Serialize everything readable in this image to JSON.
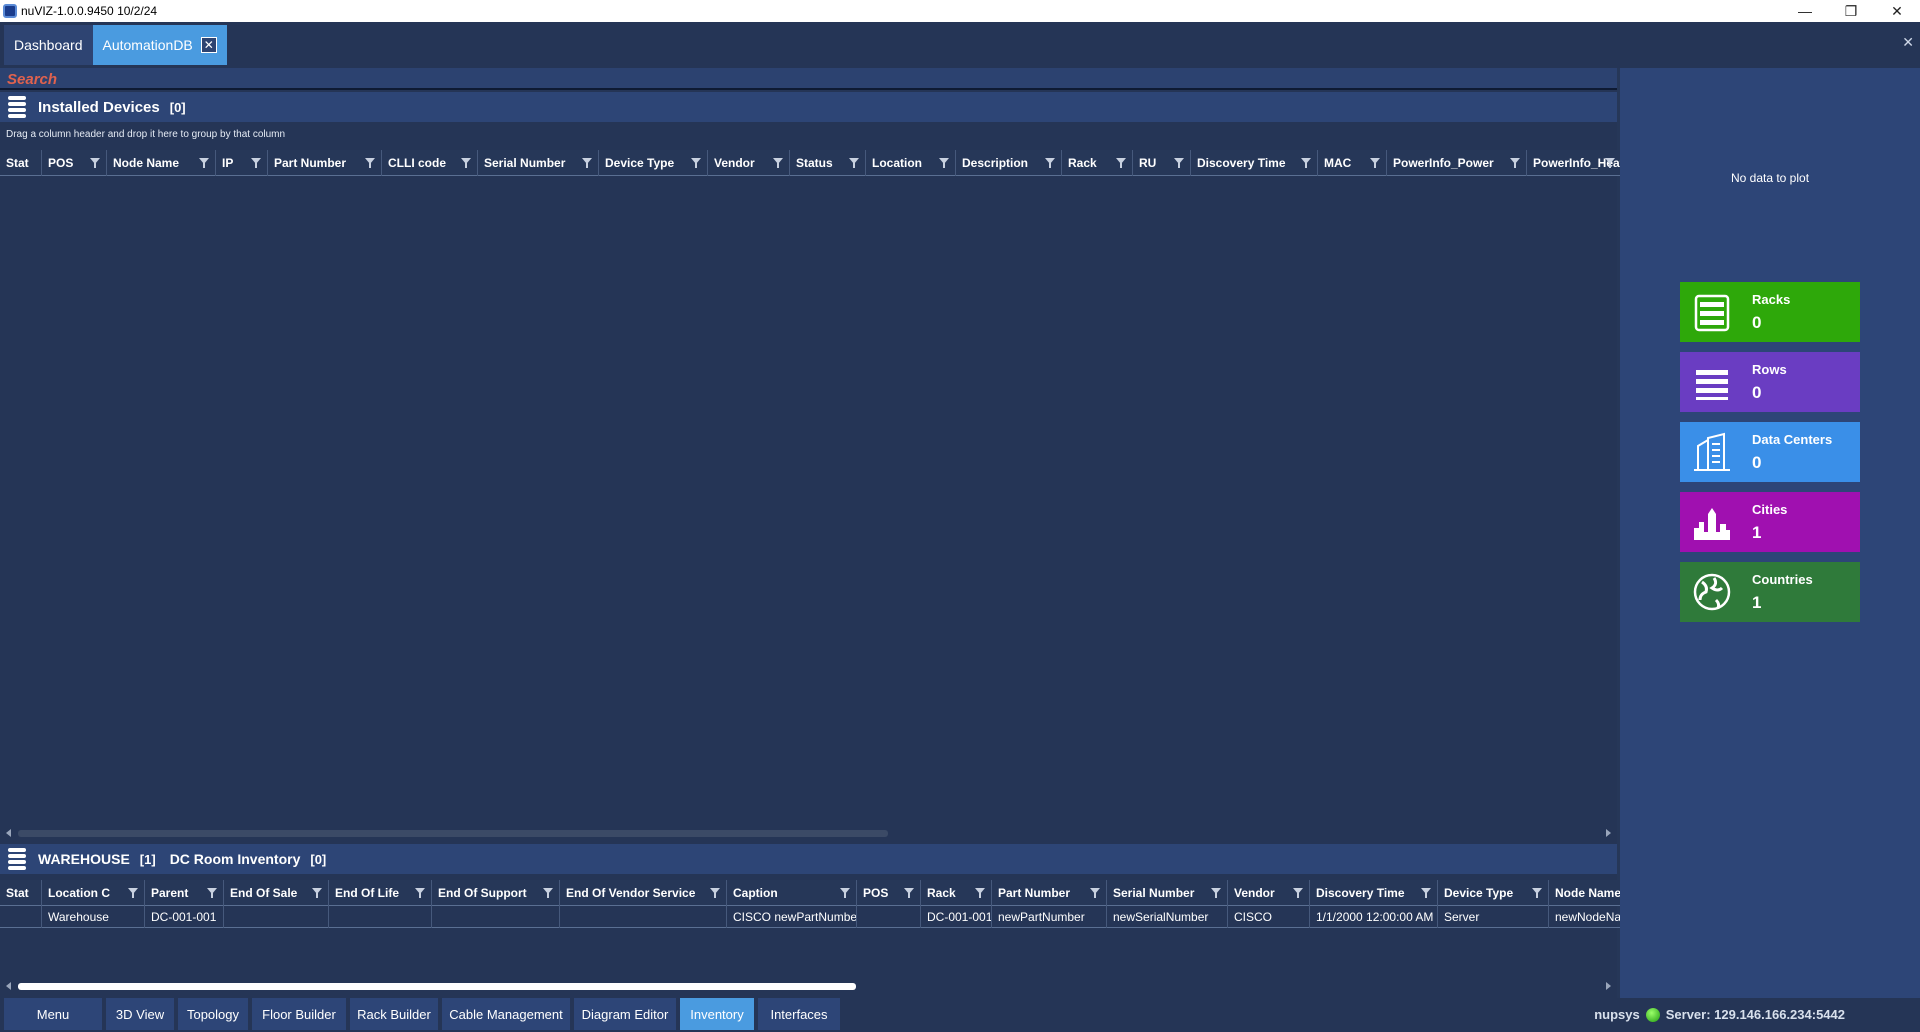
{
  "window": {
    "title": "nuVIZ-1.0.0.9450 10/2/24",
    "minimize": "—",
    "restore": "❐",
    "close": "✕"
  },
  "tabs": [
    {
      "label": "Dashboard"
    },
    {
      "label": "AutomationDB",
      "close": "✕"
    }
  ],
  "tabs_close": "✕",
  "search": {
    "label": "Search"
  },
  "installed": {
    "title": "Installed Devices",
    "count": "[0]",
    "group_hint": "Drag a column header and drop it here to group by that column",
    "columns": [
      "Stat",
      "POS",
      "Node Name",
      "IP",
      "Part Number",
      "CLLI code",
      "Serial Number",
      "Device Type",
      "Vendor",
      "Status",
      "Location",
      "Description",
      "Rack",
      "RU",
      "Discovery Time",
      "MAC",
      "PowerInfo_Power",
      "PowerInfo_Heat"
    ],
    "scroll_position": 0.55
  },
  "warehouse": {
    "title": "WAREHOUSE",
    "count": "[1]",
    "title2": "DC Room Inventory",
    "count2": "[0]",
    "columns": [
      "Stat",
      "Location C",
      "Parent",
      "End Of Sale",
      "End Of Life",
      "End Of Support",
      "End Of Vendor Service",
      "Caption",
      "POS",
      "Rack",
      "Part Number",
      "Serial Number",
      "Vendor",
      "Discovery Time",
      "Device Type",
      "Node Name"
    ],
    "rows": [
      [
        "",
        "Warehouse",
        "DC-001-001",
        "",
        "",
        "",
        "",
        "CISCO newPartNumber",
        "",
        "DC-001-001",
        "newPartNumber",
        "newSerialNumber",
        "CISCO",
        "1/1/2000 12:00:00 AM",
        "Server",
        "newNodeName"
      ]
    ],
    "scroll_position": 0.53
  },
  "right_panel": {
    "no_data": "No data to plot",
    "stats": [
      {
        "label": "Racks",
        "value": "0",
        "color": "#2ea80a",
        "icon": "rack-icon"
      },
      {
        "label": "Rows",
        "value": "0",
        "color": "#6a3dc2",
        "icon": "rows-icon"
      },
      {
        "label": "Data Centers",
        "value": "0",
        "color": "#3a8fe8",
        "icon": "datacenter-icon"
      },
      {
        "label": "Cities",
        "value": "1",
        "color": "#a010b0",
        "icon": "city-icon"
      },
      {
        "label": "Countries",
        "value": "1",
        "color": "#2f7a3a",
        "icon": "globe-icon"
      }
    ]
  },
  "bottom_nav": {
    "items": [
      "Menu",
      "3D View",
      "Topology",
      "Floor Builder",
      "Rack Builder",
      "Cable Management",
      "Diagram Editor",
      "Inventory",
      "Interfaces"
    ],
    "active": "Inventory"
  },
  "status_bar": {
    "user": "nupsys",
    "server": "Server: 129.146.166.234:5442"
  }
}
